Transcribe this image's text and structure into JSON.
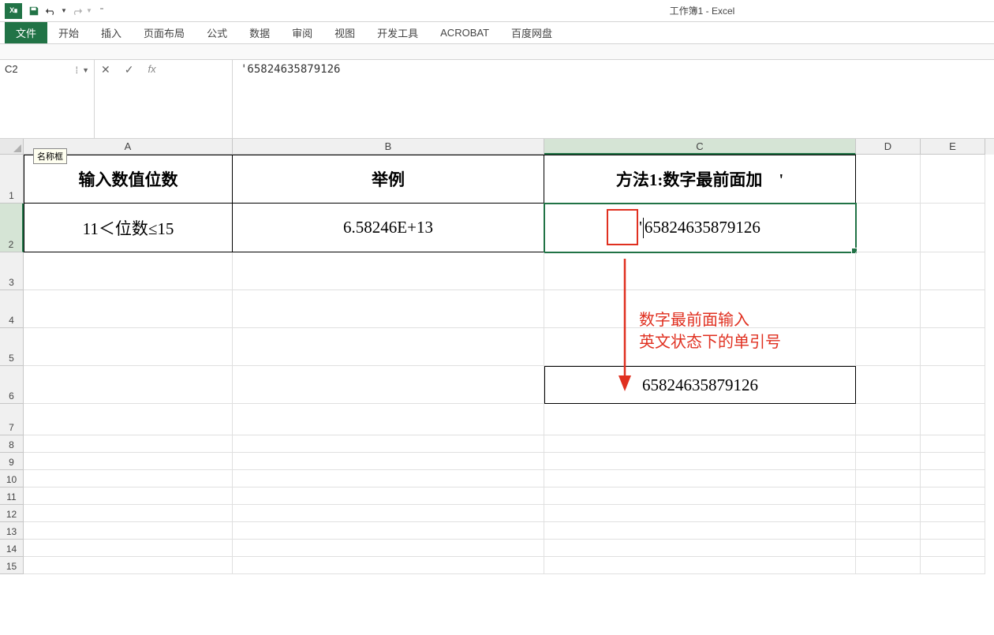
{
  "app": {
    "title": "工作簿1 - Excel"
  },
  "ribbon": {
    "tabs": [
      "文件",
      "开始",
      "插入",
      "页面布局",
      "公式",
      "数据",
      "审阅",
      "视图",
      "开发工具",
      "ACROBAT",
      "百度网盘"
    ],
    "active": 0
  },
  "formula_bar": {
    "name_box": "C2",
    "name_box_tooltip": "名称框",
    "formula": "'65824635879126"
  },
  "columns": [
    {
      "letter": "A",
      "width": "wA"
    },
    {
      "letter": "B",
      "width": "wB"
    },
    {
      "letter": "C",
      "width": "wC"
    },
    {
      "letter": "D",
      "width": "wD"
    },
    {
      "letter": "E",
      "width": "wE"
    }
  ],
  "cells": {
    "A1": "输入数值位数",
    "B1": "举例",
    "C1": "方法1:数字最前面加　'",
    "A2": "11＜位数≤15",
    "B2": "6.58246E+13",
    "C2_prefix": "'",
    "C2_num": "65824635879126",
    "C6": "65824635879126"
  },
  "annotation": {
    "line1": "数字最前面输入",
    "line2": "英文状态下的单引号"
  }
}
